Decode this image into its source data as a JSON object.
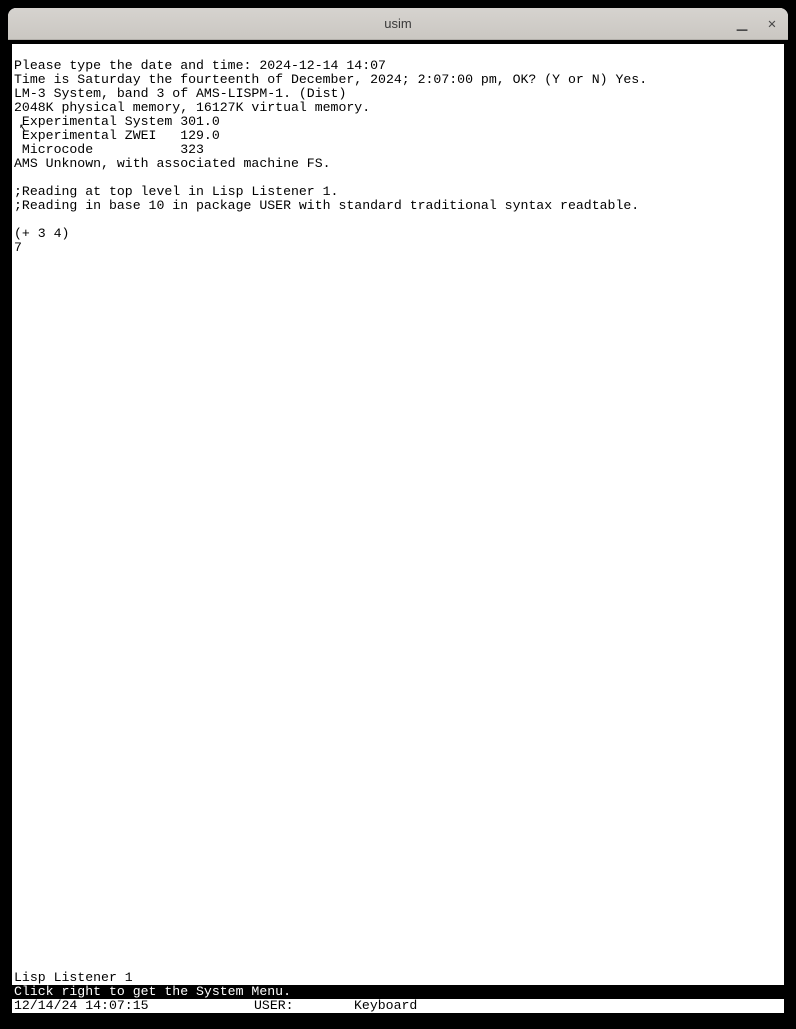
{
  "window": {
    "title": "usim"
  },
  "terminal": {
    "lines": [
      "Please type the date and time: 2024-12-14 14:07",
      "Time is Saturday the fourteenth of December, 2024; 2:07:00 pm, OK? (Y or N) Yes.",
      "LM-3 System, band 3 of AMS-LISPM-1. (Dist)",
      "2048K physical memory, 16127K virtual memory.",
      " Experimental System 301.0",
      " Experimental ZWEI   129.0",
      " Microcode           323",
      "AMS Unknown, with associated machine FS.",
      "",
      ";Reading at top level in Lisp Listener 1.",
      ";Reading in base 10 in package USER with standard traditional syntax readtable.",
      "",
      "(+ 3 4)",
      "7"
    ]
  },
  "wholine": "Lisp Listener 1",
  "menu_hint": "Click right to get the System Menu.",
  "status": {
    "datetime": "12/14/24 14:07:15",
    "user_label": "USER:",
    "input_mode": "Keyboard"
  }
}
